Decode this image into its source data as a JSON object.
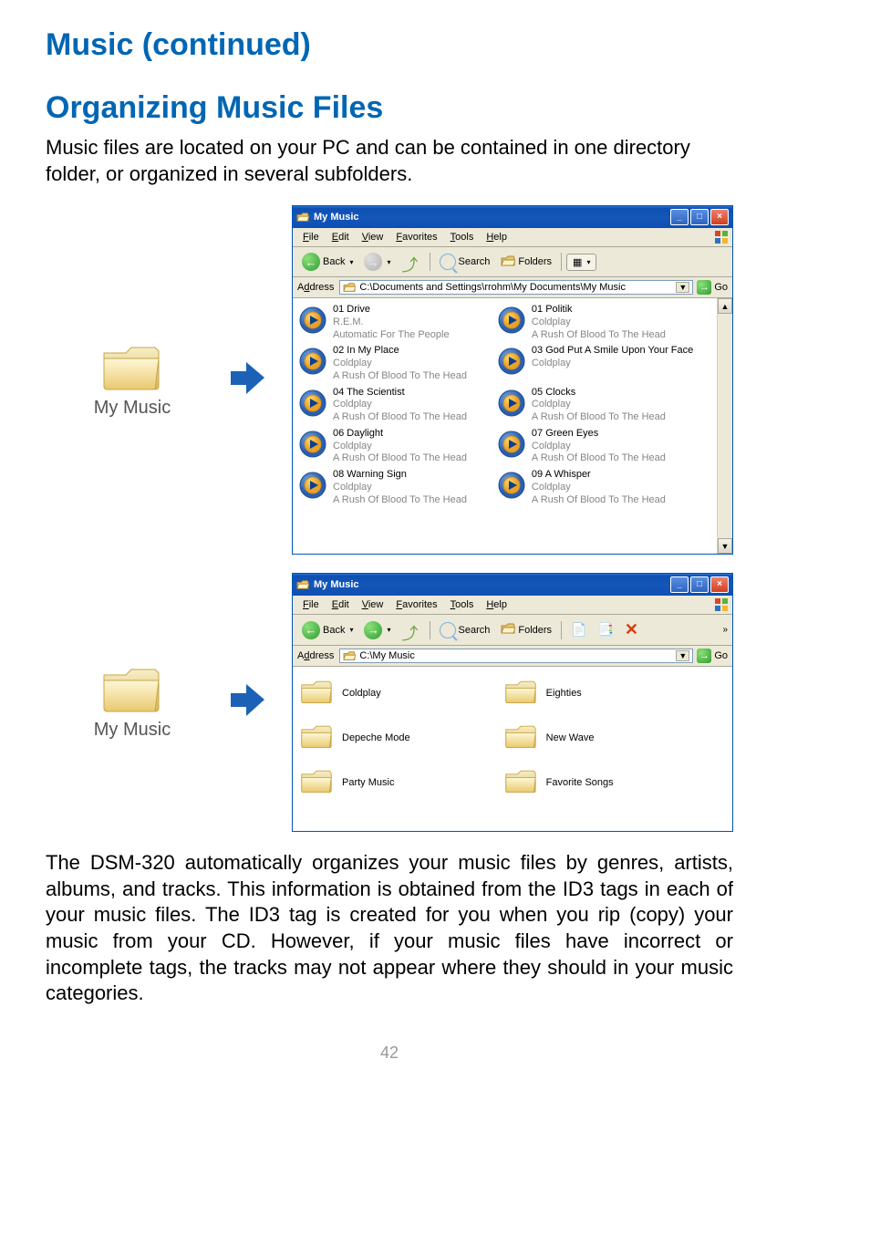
{
  "headings": {
    "h1": "Music (continued)",
    "h2": "Organizing Music Files"
  },
  "paragraphs": {
    "intro": "Music files are located on your PC and can be contained in one directory folder, or organized in several subfolders.",
    "outro": "The DSM-320 automatically organizes your music files by genres, artists, albums, and tracks. This information is obtained from the ID3 tags in each of your music files. The ID3 tag is created for you when you rip (copy) your music from your CD. However, if your music files have incorrect or incomplete tags, the tracks may not appear where they should in your music categories."
  },
  "folder_label": "My Music",
  "page_number": "42",
  "win_common": {
    "title": "My Music",
    "menu": [
      "File",
      "Edit",
      "View",
      "Favorites",
      "Tools",
      "Help"
    ],
    "back": "Back",
    "search": "Search",
    "folders": "Folders",
    "address": "Address",
    "go": "Go"
  },
  "win1": {
    "address_path": "C:\\Documents and Settings\\rrohm\\My Documents\\My Music",
    "files": [
      {
        "title": "01 Drive",
        "artist": "R.E.M.",
        "album": "Automatic For The People"
      },
      {
        "title": "01 Politik",
        "artist": "Coldplay",
        "album": "A Rush Of Blood To The Head"
      },
      {
        "title": "02 In My Place",
        "artist": "Coldplay",
        "album": "A Rush Of Blood To The Head"
      },
      {
        "title": "03 God Put A Smile Upon Your Face",
        "artist": "Coldplay",
        "album": ""
      },
      {
        "title": "04 The Scientist",
        "artist": "Coldplay",
        "album": "A Rush Of Blood To The Head"
      },
      {
        "title": "05 Clocks",
        "artist": "Coldplay",
        "album": "A Rush Of Blood To The Head"
      },
      {
        "title": "06 Daylight",
        "artist": "Coldplay",
        "album": "A Rush Of Blood To The Head"
      },
      {
        "title": "07 Green Eyes",
        "artist": "Coldplay",
        "album": "A Rush Of Blood To The Head"
      },
      {
        "title": "08 Warning Sign",
        "artist": "Coldplay",
        "album": "A Rush Of Blood To The Head"
      },
      {
        "title": "09 A Whisper",
        "artist": "Coldplay",
        "album": "A Rush Of Blood To The Head"
      }
    ]
  },
  "win2": {
    "address_path": "C:\\My Music",
    "folders": [
      "Coldplay",
      "Eighties",
      "Depeche Mode",
      "New Wave",
      "Party Music",
      "Favorite Songs"
    ]
  }
}
